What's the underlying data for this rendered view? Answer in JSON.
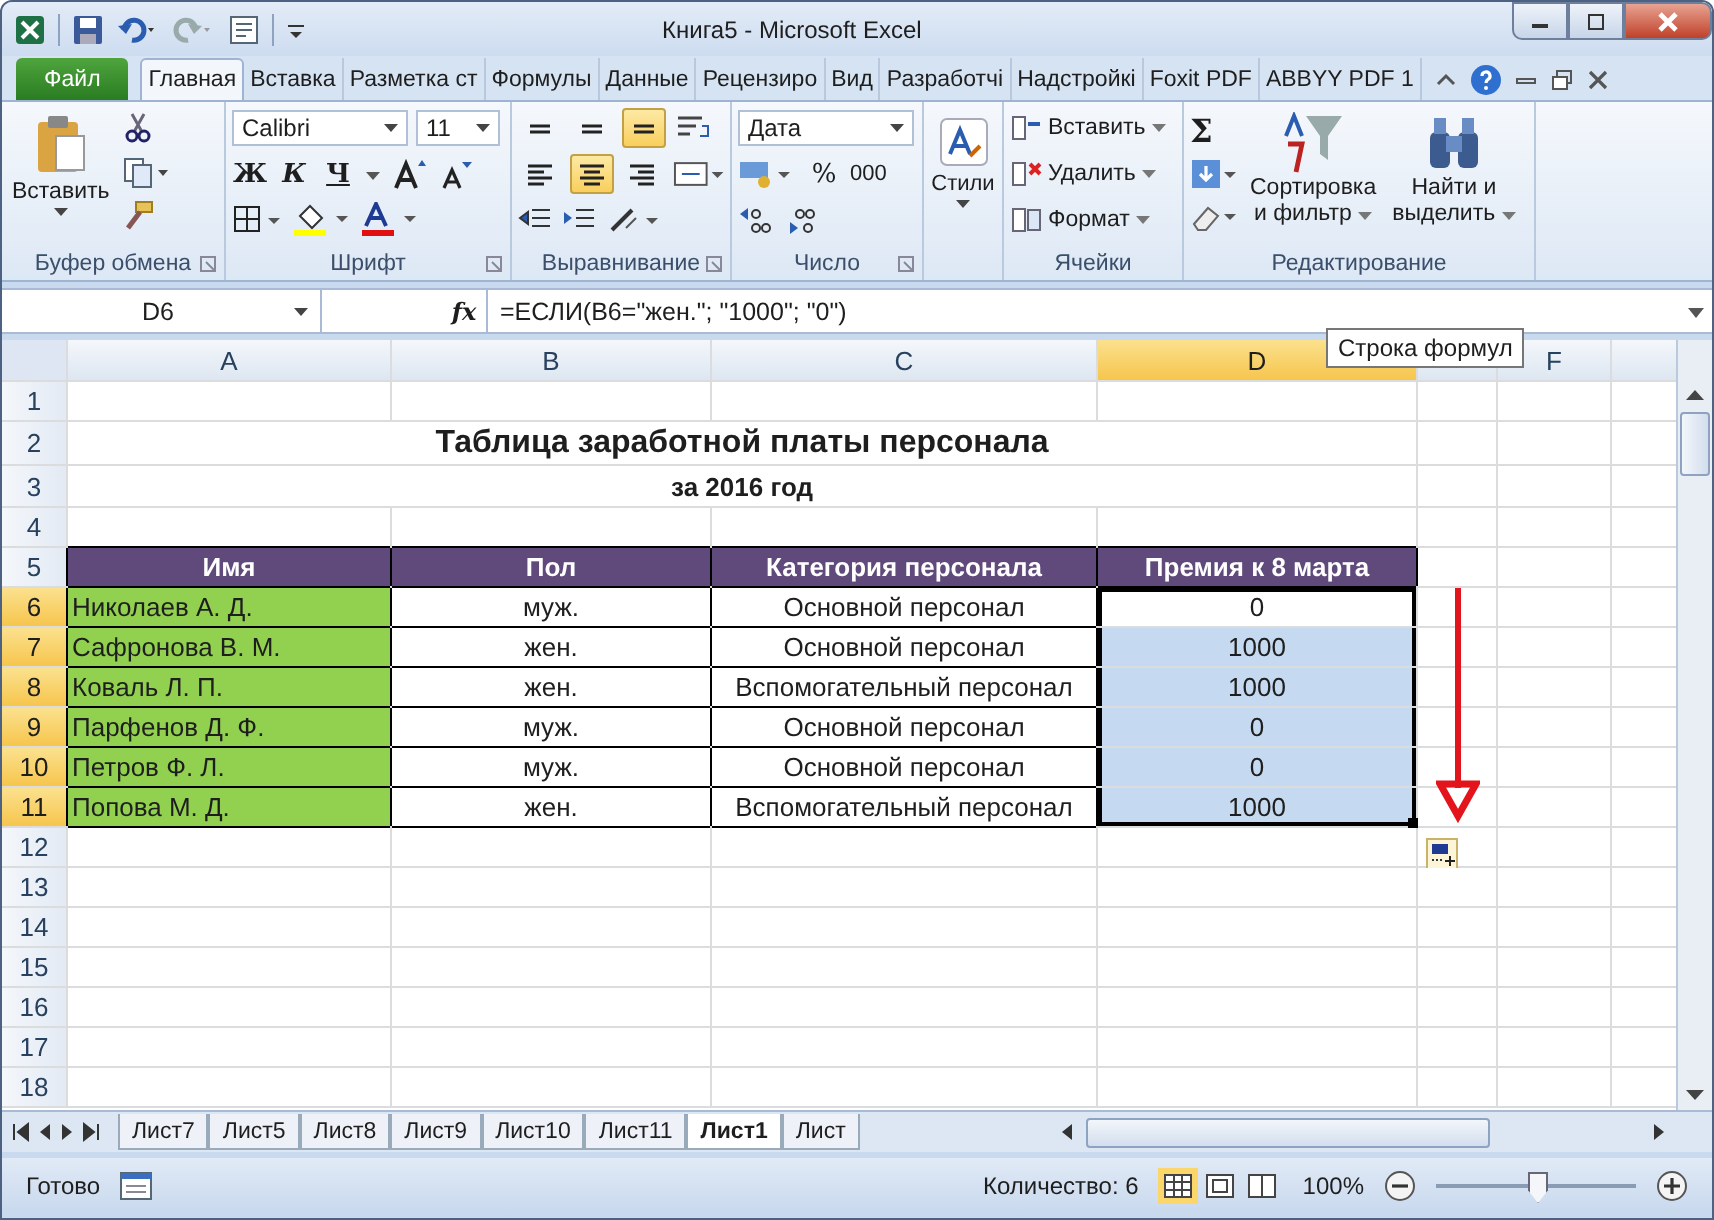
{
  "window": {
    "title": "Книга5  -  Microsoft Excel"
  },
  "ribbon_tabs": [
    {
      "label": "Файл",
      "kind": "file",
      "selected": false
    },
    {
      "label": "Главная",
      "kind": "tab",
      "selected": true
    },
    {
      "label": "Вставка",
      "kind": "tab",
      "selected": false
    },
    {
      "label": "Разметка ст",
      "kind": "tab",
      "selected": false
    },
    {
      "label": "Формулы",
      "kind": "tab",
      "selected": false
    },
    {
      "label": "Данные",
      "kind": "tab",
      "selected": false
    },
    {
      "label": "Рецензиро",
      "kind": "tab",
      "selected": false
    },
    {
      "label": "Вид",
      "kind": "tab",
      "selected": false
    },
    {
      "label": "Разработчі",
      "kind": "tab",
      "selected": false
    },
    {
      "label": "Надстройкі",
      "kind": "tab",
      "selected": false
    },
    {
      "label": "Foxit PDF",
      "kind": "tab",
      "selected": false
    },
    {
      "label": "ABBYY PDF 1",
      "kind": "tab",
      "selected": false
    }
  ],
  "ribbon_groups": [
    {
      "kind": "clipboard",
      "label": "Буфер обмена",
      "paste": "Вставить"
    },
    {
      "kind": "font",
      "label": "Шрифт",
      "font": "Calibri",
      "size": "11",
      "bold": "Ж",
      "italic": "К",
      "underline": "Ч"
    },
    {
      "kind": "alignment",
      "label": "Выравнивание",
      "align_buttons": [
        {
          "kind": "top",
          "selected": false
        },
        {
          "kind": "middle",
          "selected": false
        },
        {
          "kind": "bottom",
          "selected": true
        },
        {
          "kind": "left",
          "selected": false
        },
        {
          "kind": "center",
          "selected": true
        },
        {
          "kind": "right",
          "selected": false
        }
      ]
    },
    {
      "kind": "number",
      "label": "Число",
      "format": "Дата",
      "percent": "%",
      "thousands": "000"
    },
    {
      "kind": "styles",
      "button": "Стили"
    },
    {
      "kind": "cells",
      "label": "Ячейки",
      "buttons": [
        "Вставить",
        "Удалить",
        "Формат"
      ]
    },
    {
      "kind": "editing",
      "label": "Редактирование",
      "sigma": "Σ",
      "sort": [
        "Сортировка",
        "и фильтр"
      ],
      "find": [
        "Найти и",
        "выделить"
      ]
    }
  ],
  "formula_bar": {
    "name_box": "D6",
    "function_button": "fx",
    "formula": "=ЕСЛИ(B6=\"жен.\"; \"1000\"; \"0\")",
    "tooltip": "Строка формул"
  },
  "columns": [
    {
      "label": "A",
      "selected": false
    },
    {
      "label": "B",
      "selected": false
    },
    {
      "label": "C",
      "selected": false
    },
    {
      "label": "D",
      "selected": true
    },
    {
      "selected": false
    },
    {
      "label": "F",
      "selected": false
    }
  ],
  "rows": [
    {
      "num": "1",
      "kind": "empty",
      "selected": false
    },
    {
      "num": "2",
      "kind": "title",
      "selected": false,
      "text": "Таблица заработной платы персонала"
    },
    {
      "num": "3",
      "kind": "subtitle",
      "selected": false,
      "text": "за 2016 год"
    },
    {
      "num": "4",
      "kind": "empty",
      "selected": false
    },
    {
      "num": "5",
      "kind": "header",
      "selected": false,
      "cells": [
        "Имя",
        "Пол",
        "Категория персонала",
        "Премия к 8 марта"
      ]
    },
    {
      "num": "6",
      "kind": "data",
      "selected": true,
      "name": "Николаев А. Д.",
      "gender": "муж.",
      "category": "Основной персонал",
      "bonus": "0",
      "highlighted": false
    },
    {
      "num": "7",
      "kind": "data",
      "selected": true,
      "name": "Сафронова В. М.",
      "gender": "жен.",
      "category": "Основной персонал",
      "bonus": "1000",
      "highlighted": true
    },
    {
      "num": "8",
      "kind": "data",
      "selected": true,
      "name": "Коваль Л. П.",
      "gender": "жен.",
      "category": "Вспомогательный персонал",
      "bonus": "1000",
      "highlighted": true
    },
    {
      "num": "9",
      "kind": "data",
      "selected": true,
      "name": "Парфенов Д. Ф.",
      "gender": "муж.",
      "category": "Основной персонал",
      "bonus": "0",
      "highlighted": true
    },
    {
      "num": "10",
      "kind": "data",
      "selected": true,
      "name": "Петров Ф. Л.",
      "gender": "муж.",
      "category": "Основной персонал",
      "bonus": "0",
      "highlighted": true
    },
    {
      "num": "11",
      "kind": "data",
      "selected": true,
      "name": "Попова М. Д.",
      "gender": "жен.",
      "category": "Вспомогательный персонал",
      "bonus": "1000",
      "highlighted": true
    },
    {
      "num": "12",
      "kind": "empty",
      "selected": false
    },
    {
      "num": "13",
      "kind": "empty",
      "selected": false
    },
    {
      "num": "14",
      "kind": "empty",
      "selected": false
    },
    {
      "num": "15",
      "kind": "empty",
      "selected": false
    },
    {
      "num": "16",
      "kind": "empty",
      "selected": false
    },
    {
      "num": "17",
      "kind": "empty",
      "selected": false
    },
    {
      "num": "18",
      "kind": "empty",
      "selected": false
    }
  ],
  "sheet_tabs": [
    {
      "label": "Лист7",
      "selected": false
    },
    {
      "label": "Лист5",
      "selected": false
    },
    {
      "label": "Лист8",
      "selected": false
    },
    {
      "label": "Лист9",
      "selected": false
    },
    {
      "label": "Лист10",
      "selected": false
    },
    {
      "label": "Лист11",
      "selected": false
    },
    {
      "label": "Лист1",
      "selected": true
    },
    {
      "label": "Лист",
      "selected": false
    }
  ],
  "status_bar": {
    "status": "Готово",
    "count": "Количество: 6",
    "zoom": "100%",
    "zoom_level": {
      "level": 0.5
    }
  }
}
